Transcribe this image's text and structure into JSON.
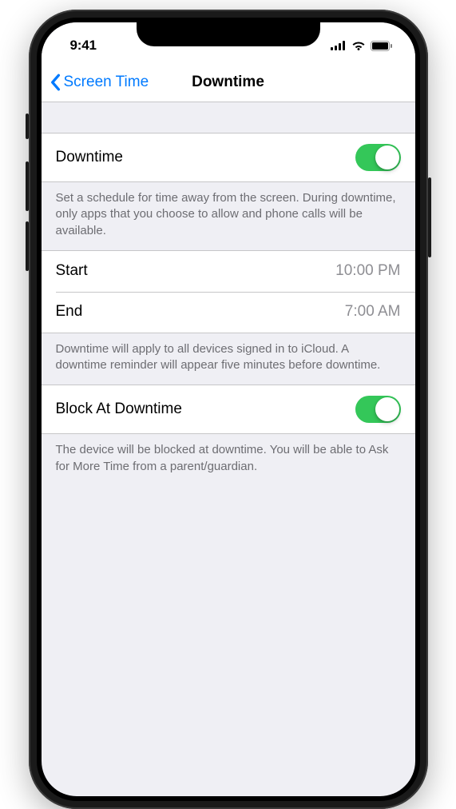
{
  "status": {
    "time": "9:41"
  },
  "nav": {
    "back_label": "Screen Time",
    "title": "Downtime"
  },
  "rows": {
    "downtime": {
      "label": "Downtime",
      "enabled": true,
      "footer": "Set a schedule for time away from the screen. During downtime, only apps that you choose to allow and phone calls will be available."
    },
    "start": {
      "label": "Start",
      "value": "10:00 PM"
    },
    "end": {
      "label": "End",
      "value": "7:00 AM"
    },
    "schedule_footer": "Downtime will apply to all devices signed in to iCloud. A downtime reminder will appear five minutes before downtime.",
    "block": {
      "label": "Block At Downtime",
      "enabled": true,
      "footer": "The device will be blocked at downtime. You will be able to Ask for More Time from a parent/guardian."
    }
  },
  "colors": {
    "accent": "#007aff",
    "toggle_on": "#34c759",
    "group_bg": "#efeff4",
    "secondary_text": "#8e8e93",
    "footer_text": "#6d6d72"
  }
}
